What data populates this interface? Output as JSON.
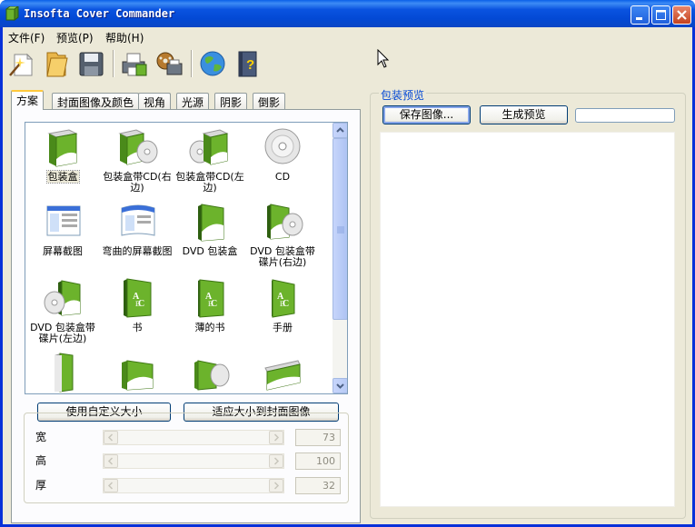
{
  "window": {
    "title": "Insofta Cover Commander"
  },
  "menubar": {
    "items": [
      "文件(F)",
      "预览(P)",
      "帮助(H)"
    ]
  },
  "toolbar": {
    "tools": [
      "new-project-icon",
      "open-folder-icon",
      "save-disk-icon",
      "print-icon",
      "media-print-icon",
      "globe-icon",
      "help-book-icon"
    ]
  },
  "tabs": [
    "方案",
    "封面图像及颜色",
    "视角",
    "光源",
    "阴影",
    "倒影"
  ],
  "active_tab": "方案",
  "gallery": {
    "items": [
      {
        "label": "包装盒",
        "selected": true
      },
      {
        "label": "包装盒带CD(右边)"
      },
      {
        "label": "包装盒带CD(左边)"
      },
      {
        "label": "CD"
      },
      {
        "label": "屏幕截图"
      },
      {
        "label": "弯曲的屏幕截图"
      },
      {
        "label": "DVD 包装盒"
      },
      {
        "label": "DVD 包装盒带碟片(右边)"
      },
      {
        "label": "DVD 包装盒带碟片(左边)"
      },
      {
        "label": "书"
      },
      {
        "label": "薄的书"
      },
      {
        "label": "手册"
      }
    ]
  },
  "size": {
    "custom_button": "使用自定义大小",
    "fit_button": "适应大小到封面图像",
    "rows": [
      {
        "label": "宽",
        "value": "73"
      },
      {
        "label": "高",
        "value": "100"
      },
      {
        "label": "厚",
        "value": "32"
      }
    ]
  },
  "preview": {
    "group_label": "包装预览",
    "save_button": "保存图像...",
    "generate_button": "生成预览"
  },
  "colors": {
    "title_bar": "#0a53e0",
    "face": "#ece9d8",
    "box_green": "#6cb32c"
  }
}
